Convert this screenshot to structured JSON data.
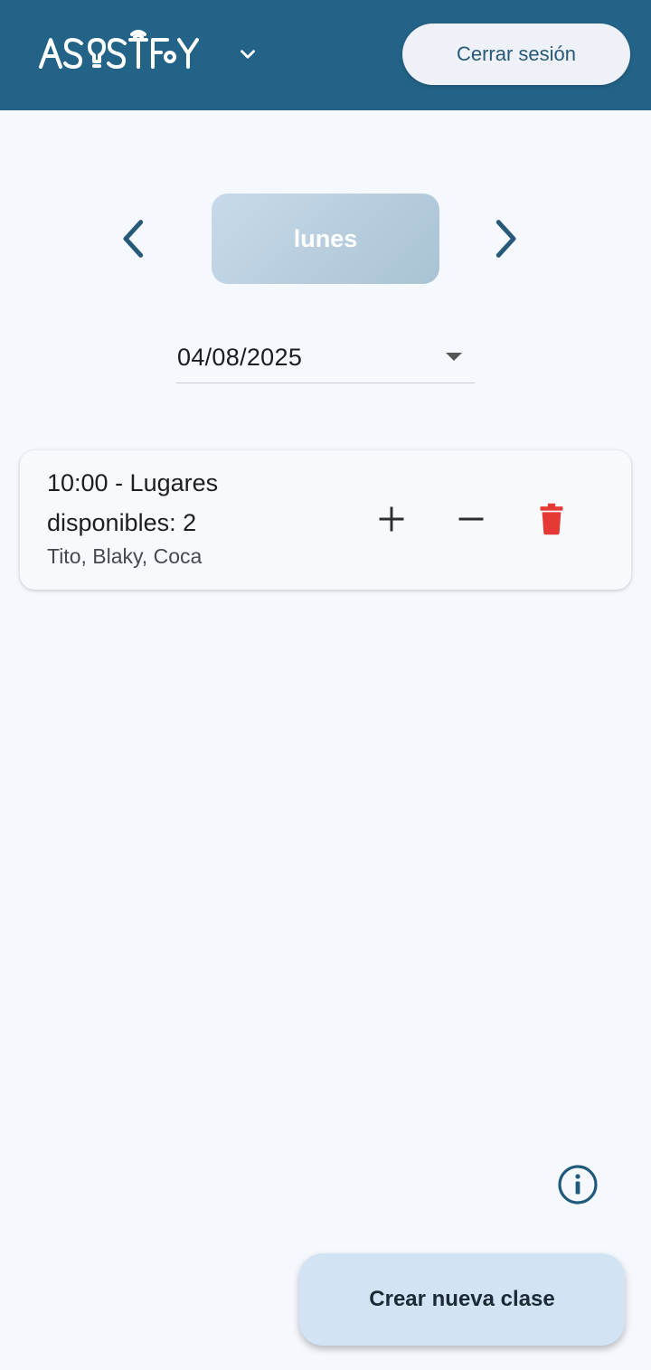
{
  "header": {
    "logo_text": "ASOSTFY",
    "logout_label": "Cerrar sesión",
    "logo_dropdown_icon": "chevron-down-icon",
    "colors": {
      "appbar": "#236387",
      "logout_bg": "#eef2f8",
      "logout_text": "#27597a"
    }
  },
  "day_selector": {
    "day_label": "lunes",
    "prev_icon": "chevron-left-icon",
    "next_icon": "chevron-right-icon"
  },
  "date_picker": {
    "value": "04/08/2025",
    "icon": "caret-down-icon"
  },
  "classes": [
    {
      "title": "10:00 - Lugares disponibles: 2",
      "attendees": "Tito, Blaky, Coca",
      "actions": {
        "add_icon": "plus-icon",
        "remove_icon": "minus-icon",
        "delete_icon": "trash-icon"
      },
      "delete_color": "#e53935"
    }
  ],
  "info_icon": "info-icon",
  "fab": {
    "label": "Crear nueva clase",
    "bg": "#d2e4f3"
  }
}
